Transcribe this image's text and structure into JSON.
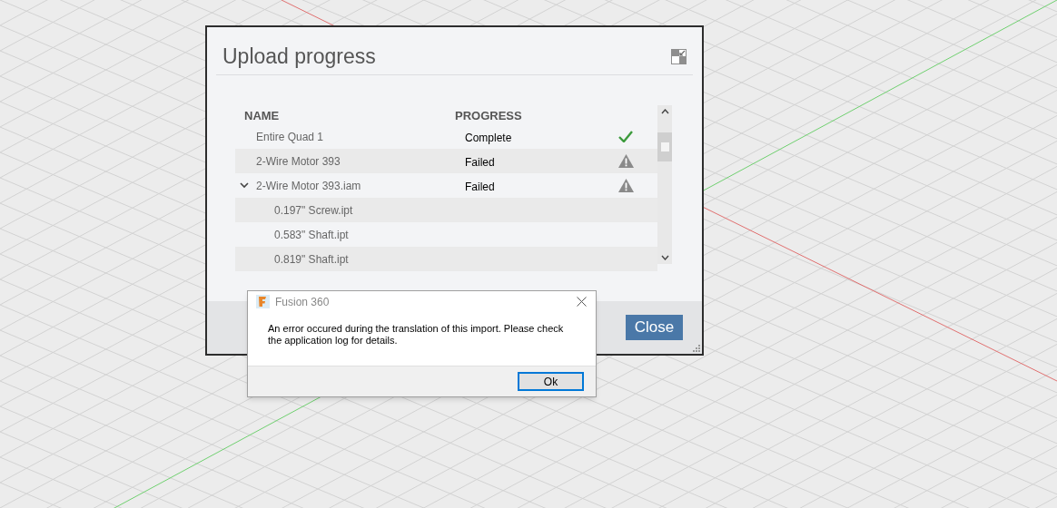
{
  "upload_dialog": {
    "title": "Upload progress",
    "columns": [
      "NAME",
      "PROGRESS"
    ],
    "rows": [
      {
        "name": "Entire Quad 1",
        "progress": "Complete",
        "kind": "complete"
      },
      {
        "name": "2-Wire Motor 393",
        "progress": "Failed",
        "kind": "failed"
      },
      {
        "name": "2-Wire Motor 393.iam",
        "progress": "Failed",
        "kind": "failed",
        "expanded": true,
        "children": [
          {
            "name": "0.197\" Screw.ipt"
          },
          {
            "name": "0.583\" Shaft.ipt"
          },
          {
            "name": "0.819\" Shaft.ipt"
          }
        ]
      }
    ],
    "close_button": "Close"
  },
  "message_box": {
    "title": "Fusion 360",
    "message": "An error occured during the translation of this import. Please check the application log for details.",
    "ok_button": "Ok"
  }
}
